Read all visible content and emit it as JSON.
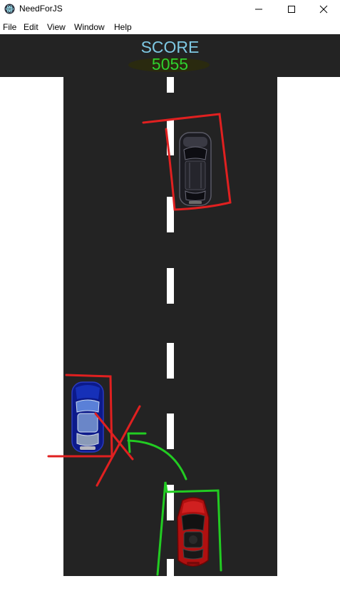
{
  "window": {
    "title": "NeedForJS"
  },
  "menu": {
    "items": [
      "File",
      "Edit",
      "View",
      "Window",
      "Help"
    ]
  },
  "score": {
    "label": "SCORE",
    "value": "5055"
  },
  "colors": {
    "road": "#232323",
    "lane": "#ffffff",
    "score_label": "#7ec8e3",
    "score_value": "#2fd12f",
    "annotation_red": "#e02020",
    "annotation_green": "#22cc22"
  },
  "cars": [
    {
      "kind": "enemy-car",
      "color": "black"
    },
    {
      "kind": "enemy-car",
      "color": "blue"
    },
    {
      "kind": "player-car",
      "color": "red"
    }
  ],
  "icons": [
    "electron-app-icon",
    "minimize-icon",
    "maximize-icon",
    "close-icon"
  ]
}
